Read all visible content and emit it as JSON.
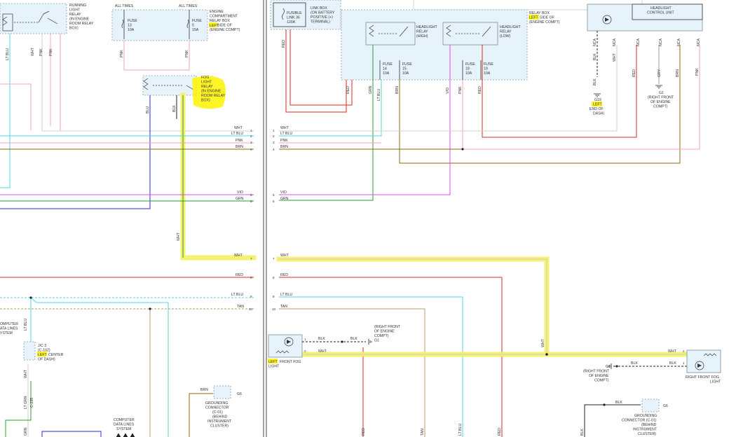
{
  "colors": {
    "wht": "#cfcfcf",
    "lt_blu": "#4fd6e6",
    "pnk": "#f3a3c4",
    "brn": "#8b6914",
    "vio": "#e04be8",
    "grn": "#2e9b2e",
    "red": "#e02424",
    "tan": "#b79a6a",
    "blu": "#2a2ad8",
    "blk": "#222222",
    "gry": "#999999",
    "highlight": "#fff200"
  },
  "left_panel": {
    "running_light_relay": [
      "RUNNING",
      "LIGHT",
      "RELAY",
      "(IN ENGINE",
      "ROOM RELAY",
      "BOX)"
    ],
    "all_times_1": "ALL TIMES",
    "all_times_2": "ALL TIMES",
    "engine_relay_box": [
      "ENGINE",
      "COMPARTMENT",
      "RELAY BOX",
      "SIDE OF",
      "(ENGINE COMPT)"
    ],
    "engine_relay_box_left": "LEFT",
    "fuse13": [
      "FUSE",
      "13",
      "10A"
    ],
    "fuse5": [
      "FUSE",
      "5",
      "15A"
    ],
    "fog_relay": [
      "FOG",
      "LIGHT",
      "RELAY",
      "(IN ENGINE",
      "ROOM RELAY",
      "BOX)"
    ],
    "jc3": [
      "J/C 3",
      "(C-102)",
      "CENTER",
      "OF DASH)"
    ],
    "jc3_left": "LEFT",
    "computer_data_lines_cut": [
      "OMPUTER",
      "ATA LINES",
      "YSTEM"
    ],
    "grounding_connector": [
      "GROUNDING",
      "CONNECTOR",
      "(C-01)",
      "(BEHIND",
      "INSTRUMENT",
      "CLUSTER)"
    ],
    "computer_data_lines": [
      "COMPUTER",
      "DATA LINES",
      "SYSTEM"
    ],
    "g6": "G6",
    "brn_g6": "BRN",
    "wire_labels": [
      "WHT",
      "LT BLU",
      "PNK",
      "BRN",
      "VIO",
      "GRN",
      "WHT",
      "RED",
      "LT BLU",
      "TAN"
    ],
    "wire_pins": [
      "1",
      "2",
      "3",
      "4",
      "5",
      "6",
      "7",
      "8",
      "9",
      "10"
    ],
    "v_labels": {
      "lt_blu": "LT BLU",
      "wht": "WHT",
      "pnk": "PNK",
      "pnk2": "PNK",
      "pnk3": "PNK",
      "pnk4": "PNK",
      "blu": "BLU",
      "blk": "BLK",
      "wht_fog": "WHT",
      "lt_blu_jc": "LT BLU",
      "wht_jc": "WHT",
      "lt_grn": "LT GRN",
      "grn": "GRN",
      "c235": "C-235"
    }
  },
  "right_panel": {
    "fusible_link": [
      "FUSIBLE",
      "LINK 36",
      "120A"
    ],
    "battery_box": [
      "LINK BOX",
      "(ON BATTERY",
      "POSITIVE (+)",
      "TERMINAL)"
    ],
    "relay_box_note": [
      "RELAY BOX",
      "SIDE OF",
      "(ENGINE COMPT)"
    ],
    "relay_box_left": "LEFT",
    "headlight_relay_high": [
      "HEADLIGHT",
      "RELAY",
      "(HIGH)"
    ],
    "headlight_relay_low": [
      "HEADLIGHT",
      "RELAY",
      "(LOW)"
    ],
    "fuse14": [
      "FUSE",
      "14",
      "10A"
    ],
    "fuse15": [
      "FUSE",
      "15",
      "10A"
    ],
    "fuse18": [
      "FUSE",
      "18",
      "10A"
    ],
    "fuse19": [
      "FUSE",
      "19",
      "10A"
    ],
    "headlight_control_unit": [
      "HEADLIGHT",
      "CONTROL UNIT"
    ],
    "g19": [
      "G19",
      "END OF",
      "DASH)"
    ],
    "g19_left": "LEFT",
    "g1_top": [
      "G1",
      "(RIGHT FRONT",
      "OF ENGINE",
      "COMPT)"
    ],
    "g1_fog": [
      "(RIGHT FRONT",
      "OF ENGINE",
      "COMPT)",
      "G1"
    ],
    "g1_right": [
      "G1",
      "(RIGHT FRONT",
      "OF ENGINE",
      "COMPT)"
    ],
    "left_fog": [
      "FRONT FOG",
      "LIGHT"
    ],
    "left_fog_left": "LEFT",
    "right_fog": [
      "RIGHT FRONT FOG",
      "LIGHT"
    ],
    "grounding_connector": [
      "GROUNDING",
      "CONNECTOR (C-01)",
      "(BEHIND",
      "INSTRUMENT",
      "CLUSTER)"
    ],
    "g6": "G6",
    "wire_labels": [
      "WHT",
      "LT BLU",
      "PNK",
      "BRN",
      "VIO",
      "GRN",
      "WHT",
      "RED",
      "LT BLU",
      "TAN"
    ],
    "wire_pins": [
      "1",
      "2",
      "3",
      "4",
      "5",
      "6",
      "7",
      "8",
      "9",
      "10"
    ],
    "blk": "BLK",
    "wht": "WHT",
    "nca": "NCA",
    "v_labels": [
      "RED",
      "GRN",
      "LT BLU",
      "BRN",
      "RED",
      "V/O",
      "PNK",
      "RED",
      "BLK",
      "WHT",
      "RED",
      "GRY",
      "BRN",
      "PNK",
      "RED",
      "TAN",
      "LT BLU",
      "RED",
      "BLK",
      "WHT",
      "BLK"
    ]
  }
}
